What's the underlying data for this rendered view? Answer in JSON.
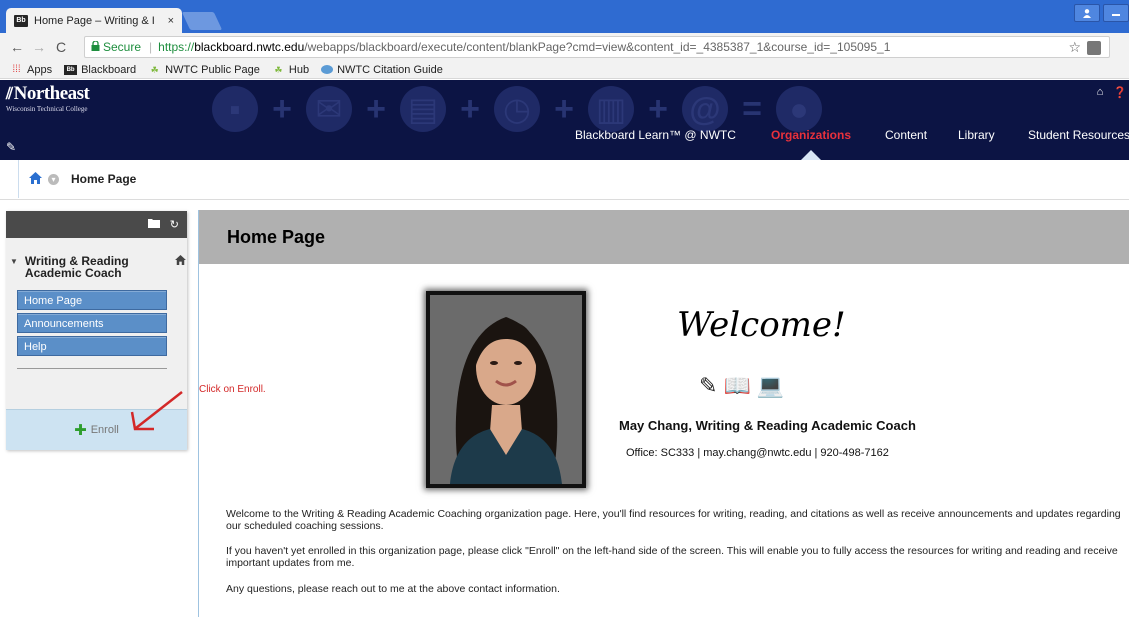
{
  "browser": {
    "tab_title": "Home Page – Writing & I",
    "tab_favicon": "Bb",
    "tab_close": "×",
    "url_secure_label": "Secure",
    "url_protocol": "https://",
    "url_host": "blackboard.nwtc.edu",
    "url_path": "/webapps/blackboard/execute/content/blankPage?cmd=view&content_id=_4385387_1&course_id=_105095_1",
    "bookmarks": [
      {
        "label": "Apps",
        "icon": "apps-grid-icon"
      },
      {
        "label": "Blackboard",
        "icon": "blackboard-icon"
      },
      {
        "label": "NWTC Public Page",
        "icon": "nwtc-icon"
      },
      {
        "label": "Hub",
        "icon": "nwtc-icon"
      },
      {
        "label": "NWTC Citation Guide",
        "icon": "cloud-icon"
      }
    ]
  },
  "header": {
    "logo_name": "Northeast",
    "logo_sub": "Wisconsin Technical College",
    "nav": [
      {
        "label": "Blackboard Learn™ @ NWTC",
        "active": false
      },
      {
        "label": "Organizations",
        "active": true
      },
      {
        "label": "Content",
        "active": false
      },
      {
        "label": "Library",
        "active": false
      },
      {
        "label": "Student Resources",
        "active": false
      }
    ],
    "accent_color": "#e8313c",
    "background_color": "#0c1444"
  },
  "breadcrumb": {
    "current": "Home Page"
  },
  "course_menu": {
    "title": "Writing & Reading Academic Coach",
    "items": [
      {
        "label": "Home Page"
      },
      {
        "label": "Announcements"
      },
      {
        "label": "Help"
      }
    ],
    "enroll_label": "Enroll"
  },
  "annotation": {
    "text": "Click on Enroll."
  },
  "content": {
    "heading": "Home Page",
    "welcome": "Welcome!",
    "coach_name": "May Chang, Writing & Reading Academic Coach",
    "office_line": "Office: SC333 | may.chang@nwtc.edu | 920-498-7162",
    "paragraphs": [
      "Welcome to the Writing & Reading Academic Coaching organization page. Here, you'll find resources for writing, reading, and citations as well as receive announcements and updates regarding our scheduled coaching sessions.",
      "If you haven't yet enrolled in this organization page, please click \"Enroll\" on the left-hand side of the screen. This will enable you to fully access the resources for writing and reading and receive important updates from me.",
      "Any questions, please reach out to me at the above contact information."
    ]
  }
}
